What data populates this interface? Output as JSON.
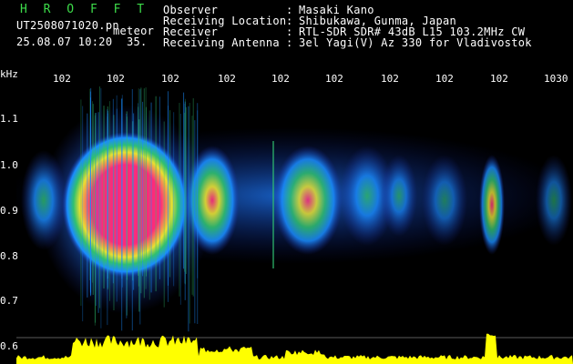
{
  "header": {
    "logo": "H R O F F T",
    "filename": "UT2508071020.pn",
    "tag": "meteor",
    "datetime": "25.08.07 10:20",
    "seconds": "35.",
    "info": [
      {
        "label": "Observer",
        "sep": ":",
        "value": "Masaki Kano"
      },
      {
        "label": "Receiving Location",
        "sep": ":",
        "value": "Shibukawa, Gunma, Japan"
      },
      {
        "label": "Receiver",
        "sep": ":",
        "value": "RTL-SDR SDR# 43dB L15 103.2MHz CW"
      },
      {
        "label": "Receiving Antenna",
        "sep": ":",
        "value": "3el Yagi(V) Az 330 for Vladivostok"
      }
    ]
  },
  "axis": {
    "y_unit": "kHz",
    "y_ticks": [
      "1.1",
      "1.0",
      "0.9",
      "0.8",
      "0.7",
      "0.6"
    ],
    "x_ticks": [
      "102",
      "102",
      "102",
      "102",
      "102",
      "102",
      "102",
      "102",
      "102",
      "1030"
    ]
  },
  "colors": {
    "background": "#000000",
    "text": "#ffffff",
    "logo": "#3ddc4a",
    "hot": "#ff2a7a",
    "warm": "#e8e030",
    "mid": "#30c070",
    "cool": "#1a8cff",
    "cold": "#1a2aa0",
    "spectrum": "#ffff00"
  }
}
